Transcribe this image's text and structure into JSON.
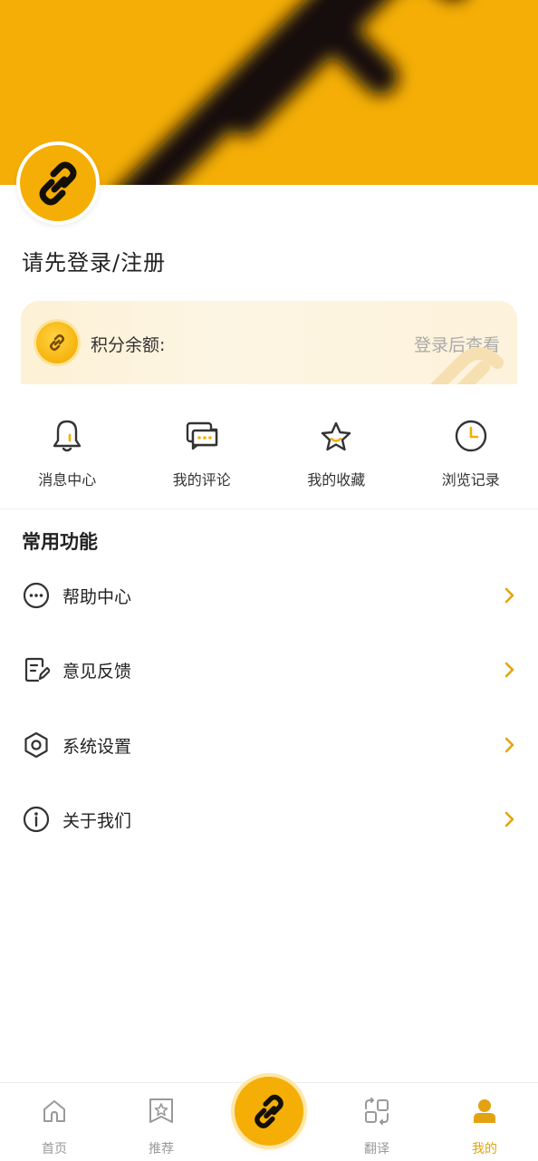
{
  "profile": {
    "login_title": "请先登录/注册"
  },
  "points": {
    "label": "积分余额:",
    "action": "登录后查看"
  },
  "quick_actions": [
    {
      "label": "消息中心",
      "icon": "bell-icon"
    },
    {
      "label": "我的评论",
      "icon": "comment-icon"
    },
    {
      "label": "我的收藏",
      "icon": "star-icon"
    },
    {
      "label": "浏览记录",
      "icon": "clock-icon"
    }
  ],
  "section": {
    "title": "常用功能"
  },
  "menu": [
    {
      "label": "帮助中心",
      "icon": "help-dots-icon"
    },
    {
      "label": "意见反馈",
      "icon": "feedback-icon"
    },
    {
      "label": "系统设置",
      "icon": "settings-hexagon-icon"
    },
    {
      "label": "关于我们",
      "icon": "info-icon"
    }
  ],
  "tabbar": {
    "tabs": [
      {
        "label": "首页",
        "icon": "home-icon",
        "active": false
      },
      {
        "label": "推荐",
        "icon": "bookmark-star-icon",
        "active": false
      },
      {
        "label": "翻译",
        "icon": "translate-icon",
        "active": false
      },
      {
        "label": "我的",
        "icon": "user-icon",
        "active": true
      }
    ],
    "center_icon": "link-icon"
  },
  "colors": {
    "brand": "#f5ae05",
    "accent_text": "#e3a311",
    "muted": "#999999"
  }
}
